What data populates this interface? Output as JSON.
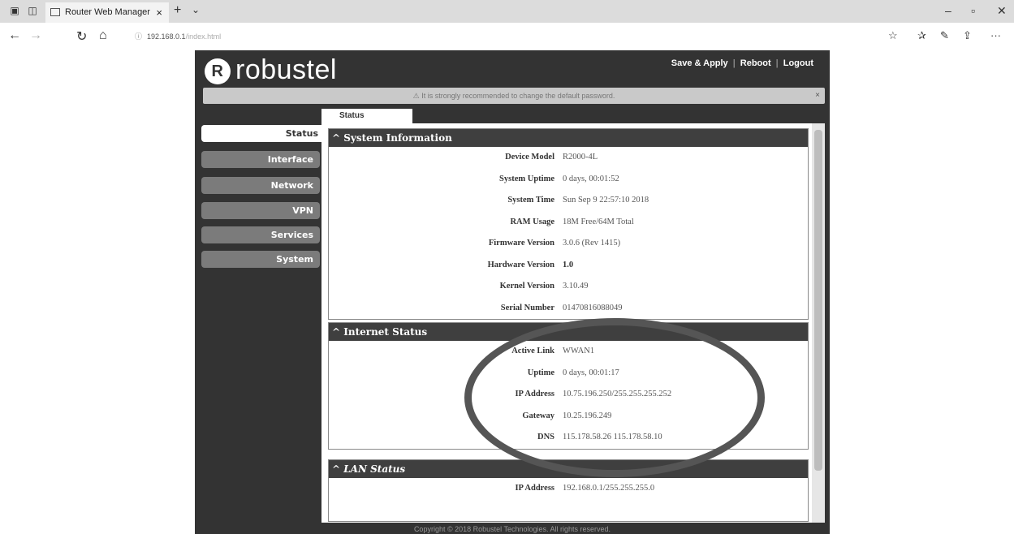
{
  "browser": {
    "tab_title": "Router Web Manager",
    "tab_close": "×",
    "new_tab": "+",
    "tab_menu": "⌄",
    "url_host": "192.168.0.1",
    "url_path": "/index.html",
    "back": "←",
    "forward": "→",
    "refresh": "↻",
    "home": "⌂",
    "minimize": "–",
    "maximize": "▫",
    "close": "✕",
    "favorite": "☆",
    "favorites_bar": "✰",
    "notes": "✎",
    "share": "⇪",
    "more": "···"
  },
  "header": {
    "logo_mark": "R",
    "logo_text": "robustel",
    "links": [
      "Save & Apply",
      "Reboot",
      "Logout"
    ]
  },
  "warning": {
    "icon": "⚠",
    "text": "It is strongly recommended to change the default password.",
    "close": "×"
  },
  "content_tab": "Status",
  "sidebar": {
    "items": [
      {
        "label": "Status"
      },
      {
        "label": "Interface"
      },
      {
        "label": "Network"
      },
      {
        "label": "VPN"
      },
      {
        "label": "Services"
      },
      {
        "label": "System"
      }
    ]
  },
  "system_info": {
    "title": "^ System Information",
    "rows": [
      {
        "label": "Device Model",
        "value": "R2000-4L"
      },
      {
        "label": "System Uptime",
        "value": "0 days, 00:01:52"
      },
      {
        "label": "System Time",
        "value": "Sun Sep 9 22:57:10 2018"
      },
      {
        "label": "RAM Usage",
        "value": "18M Free/64M Total"
      },
      {
        "label": "Firmware Version",
        "value": "3.0.6 (Rev 1415)"
      },
      {
        "label": "Hardware Version",
        "value": "1.0"
      },
      {
        "label": "Kernel Version",
        "value": "3.10.49"
      },
      {
        "label": "Serial Number",
        "value": "01470816088049"
      }
    ]
  },
  "internet_status": {
    "title": "^ Internet Status",
    "rows": [
      {
        "label": "Active Link",
        "value": "WWAN1"
      },
      {
        "label": "Uptime",
        "value": "0 days, 00:01:17"
      },
      {
        "label": "IP Address",
        "value": "10.75.196.250/255.255.255.252"
      },
      {
        "label": "Gateway",
        "value": "10.25.196.249"
      },
      {
        "label": "DNS",
        "value": "115.178.58.26 115.178.58.10"
      }
    ]
  },
  "lan_status": {
    "title": "^ LAN Status",
    "rows": [
      {
        "label": "IP Address",
        "value": "192.168.0.1/255.255.255.0"
      }
    ]
  },
  "footer": "Copyright © 2018 Robustel Technologies. All rights reserved."
}
